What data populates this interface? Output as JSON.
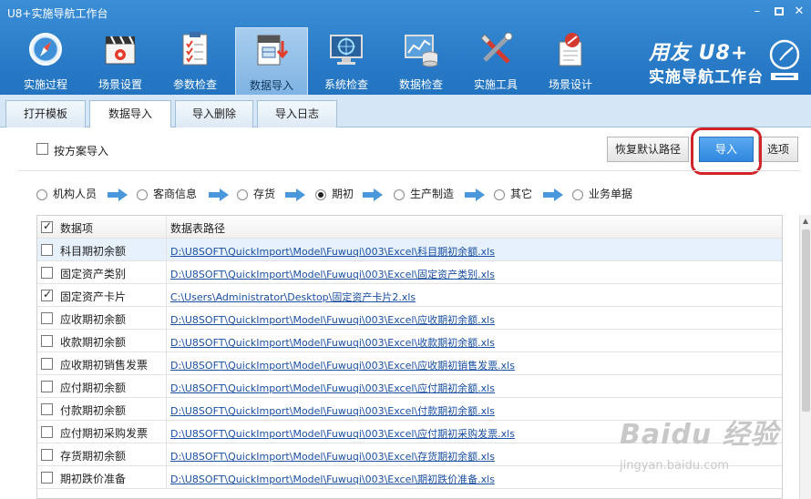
{
  "window": {
    "title": "U8+实施导航工作台",
    "min": "–",
    "close": "✕"
  },
  "toolbar": [
    {
      "label": "实施过程",
      "icon": "compass-icon"
    },
    {
      "label": "场景设置",
      "icon": "clapperboard-icon"
    },
    {
      "label": "参数检查",
      "icon": "checklist-icon"
    },
    {
      "label": "数据导入",
      "icon": "file-import-icon",
      "active": true
    },
    {
      "label": "系统检查",
      "icon": "monitor-target-icon"
    },
    {
      "label": "数据检查",
      "icon": "database-chart-icon"
    },
    {
      "label": "实施工具",
      "icon": "tools-icon"
    },
    {
      "label": "场景设计",
      "icon": "design-pen-icon"
    }
  ],
  "brand": {
    "line1": "用友 U8+",
    "line2": "实施导航工作台"
  },
  "tabs": [
    {
      "label": "打开模板"
    },
    {
      "label": "数据导入",
      "active": true
    },
    {
      "label": "导入删除"
    },
    {
      "label": "导入日志"
    }
  ],
  "scheme_import": {
    "label": "按方案导入",
    "checked": false
  },
  "buttons": {
    "restore": "恢复默认路径",
    "import": "导入",
    "options": "选项"
  },
  "steps": [
    {
      "label": "机构人员",
      "selected": false
    },
    {
      "label": "客商信息",
      "selected": false
    },
    {
      "label": "存货",
      "selected": false
    },
    {
      "label": "期初",
      "selected": true
    },
    {
      "label": "生产制造",
      "selected": false
    },
    {
      "label": "其它",
      "selected": false
    },
    {
      "label": "业务单据",
      "selected": false
    }
  ],
  "grid": {
    "headers": {
      "item": "数据项",
      "path": "数据表路径"
    },
    "rows": [
      {
        "item": "科目期初余额",
        "path": "D:\\U8SOFT\\QuickImport\\Model\\Fuwuqi\\003\\Excel\\科目期初余额.xls",
        "checked": false,
        "selected": true
      },
      {
        "item": "固定资产类别",
        "path": "D:\\U8SOFT\\QuickImport\\Model\\Fuwuqi\\003\\Excel\\固定资产类别.xls",
        "checked": false
      },
      {
        "item": "固定资产卡片",
        "path": "C:\\Users\\Administrator\\Desktop\\固定资产卡片2.xls",
        "checked": true
      },
      {
        "item": "应收期初余额",
        "path": "D:\\U8SOFT\\QuickImport\\Model\\Fuwuqi\\003\\Excel\\应收期初余额.xls",
        "checked": false
      },
      {
        "item": "收款期初余额",
        "path": "D:\\U8SOFT\\QuickImport\\Model\\Fuwuqi\\003\\Excel\\收款期初余额.xls",
        "checked": false
      },
      {
        "item": "应收期初销售发票",
        "path": "D:\\U8SOFT\\QuickImport\\Model\\Fuwuqi\\003\\Excel\\应收期初销售发票.xls",
        "checked": false
      },
      {
        "item": "应付期初余额",
        "path": "D:\\U8SOFT\\QuickImport\\Model\\Fuwuqi\\003\\Excel\\应付期初余额.xls",
        "checked": false
      },
      {
        "item": "付款期初余额",
        "path": "D:\\U8SOFT\\QuickImport\\Model\\Fuwuqi\\003\\Excel\\付款期初余额.xls",
        "checked": false
      },
      {
        "item": "应付期初采购发票",
        "path": "D:\\U8SOFT\\QuickImport\\Model\\Fuwuqi\\003\\Excel\\应付期初采购发票.xls",
        "checked": false
      },
      {
        "item": "存货期初余额",
        "path": "D:\\U8SOFT\\QuickImport\\Model\\Fuwuqi\\003\\Excel\\存货期初余额.xls",
        "checked": false
      },
      {
        "item": "期初跌价准备",
        "path": "D:\\U8SOFT\\QuickImport\\Model\\Fuwuqi\\003\\Excel\\期初跌价准备.xls",
        "checked": false
      }
    ]
  },
  "watermark": {
    "logo": "Baidu 经验",
    "sub": "jingyan.baidu.com"
  },
  "colors": {
    "toolbar_bg": "#2a7cc8",
    "tab_bg": "#d5e6f6",
    "link": "#1a4fa3",
    "highlight": "#d2232a",
    "import_button": "#2f87de"
  }
}
